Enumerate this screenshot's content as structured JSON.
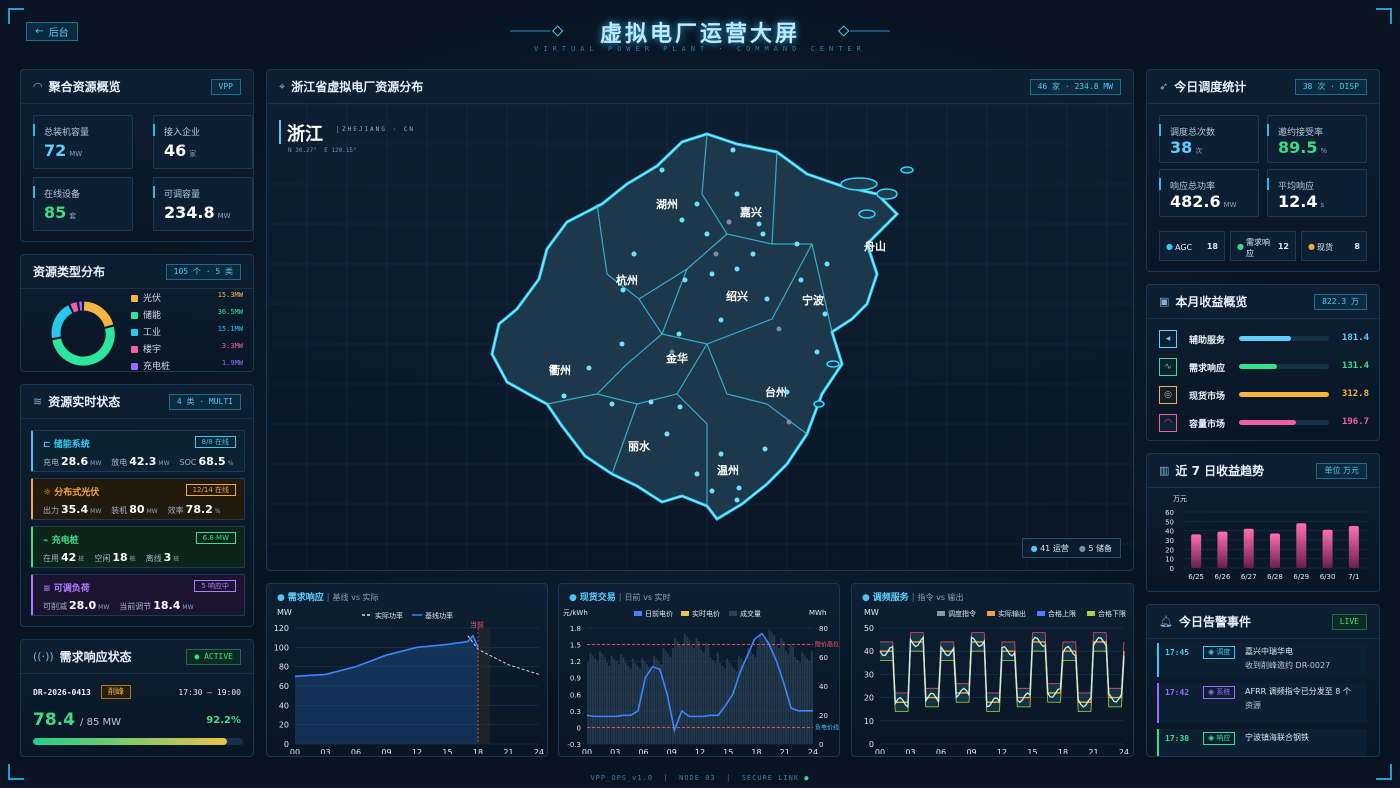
{
  "header": {
    "back_label": "后台",
    "title": "虚拟电厂运营大屏",
    "subtitle": "VIRTUAL POWER PLANT · COMMAND CENTER"
  },
  "footer": {
    "a": "VPP_OPS_v1.0",
    "b": "NODE 03",
    "c": "SECURE LINK"
  },
  "overview": {
    "title": "聚合资源概览",
    "tag": "VPP",
    "cards": [
      {
        "label": "总装机容量",
        "value": "72",
        "unit": "MW",
        "color": "#5fd0ff"
      },
      {
        "label": "接入企业",
        "value": "46",
        "unit": "家",
        "color": "#ffffff"
      },
      {
        "label": "在线设备",
        "value": "85",
        "unit": "套",
        "color": "#3ddc84"
      },
      {
        "label": "可调容量",
        "value": "234.8",
        "unit": "MW",
        "color": "#ffffff"
      }
    ]
  },
  "types": {
    "title": "资源类型分布",
    "tag": "105 个 · 5 类",
    "items": [
      {
        "name": "光伏",
        "value": "15.3MW",
        "num": 15.3,
        "color": "#f5b542"
      },
      {
        "name": "储能",
        "value": "36.5MW",
        "num": 36.5,
        "color": "#2ee59d"
      },
      {
        "name": "工业",
        "value": "15.1MW",
        "num": 15.1,
        "color": "#28c8e8"
      },
      {
        "name": "楼宇",
        "value": "3.3MW",
        "num": 3.3,
        "color": "#ef5fa6"
      },
      {
        "name": "充电桩",
        "value": "1.9MW",
        "num": 1.9,
        "color": "#9a6bff"
      }
    ]
  },
  "realtime": {
    "title": "资源实时状态",
    "tag": "4 类 · MULTI",
    "items": [
      {
        "icon": "⊏",
        "name": "储能系统",
        "badge": "8/8 在线",
        "color": "#3dc6f2",
        "bg": "#0b2233",
        "f": [
          {
            "k": "充电",
            "v": "28.6",
            "u": "MW"
          },
          {
            "k": "放电",
            "v": "42.3",
            "u": "MW"
          },
          {
            "k": "SOC",
            "v": "68.5",
            "u": "%"
          }
        ]
      },
      {
        "icon": "☼",
        "name": "分布式光伏",
        "badge": "12/14 在线",
        "color": "#f5a83a",
        "bg": "#231a0e",
        "f": [
          {
            "k": "出力",
            "v": "35.4",
            "u": "MW"
          },
          {
            "k": "装机",
            "v": "80",
            "u": "MW"
          },
          {
            "k": "效率",
            "v": "78.2",
            "u": "%"
          }
        ]
      },
      {
        "icon": "⌁",
        "name": "充电桩",
        "badge": "6.8 MW",
        "color": "#36e08a",
        "bg": "#0c2419",
        "f": [
          {
            "k": "在用",
            "v": "42",
            "u": "桩"
          },
          {
            "k": "空闲",
            "v": "18",
            "u": "桩"
          },
          {
            "k": "离线",
            "v": "3",
            "u": "桩"
          }
        ]
      },
      {
        "icon": "≡",
        "name": "可调负荷",
        "badge": "5 响应中",
        "color": "#b07bff",
        "bg": "#1b1430",
        "f": [
          {
            "k": "可削减",
            "v": "28.0",
            "u": "MW"
          },
          {
            "k": "当前调节",
            "v": "18.4",
            "u": "MW"
          }
        ]
      }
    ]
  },
  "dr": {
    "title": "需求响应状态",
    "tag": "● ACTIVE",
    "id": "DR-2026-0413",
    "badge": "削峰",
    "time": "17:30 – 19:00",
    "value": "78.4",
    "target": "/ 85 MW",
    "pct": "92.2%",
    "progress": 0.922
  },
  "map": {
    "title": "浙江省虚拟电厂资源分布",
    "tag": "46 家 · 234.8 MW",
    "region": "浙江",
    "region_en": "ZHEJIANG · CN",
    "coords": "N 30.27°  E 120.15°",
    "cities": [
      "湖州",
      "嘉兴",
      "舟山",
      "杭州",
      "绍兴",
      "宁波",
      "衢州",
      "金华",
      "台州",
      "丽水",
      "温州"
    ],
    "legend_a": "41 运营",
    "legend_b": "5 储备"
  },
  "dispatch": {
    "title": "今日调度统计",
    "tag": "38 次 · DISP",
    "cards": [
      {
        "label": "调度总次数",
        "value": "38",
        "unit": "次",
        "color": "#5fd0ff"
      },
      {
        "label": "邀约接受率",
        "value": "89.5",
        "unit": "%",
        "color": "#3ddc84"
      },
      {
        "label": "响应总功率",
        "value": "482.6",
        "unit": "MW",
        "color": "#ffffff"
      },
      {
        "label": "平均响应",
        "value": "12.4",
        "unit": "s",
        "color": "#ffffff"
      }
    ],
    "chips": [
      {
        "label": "AGC",
        "value": "18",
        "color": "#3dc6f2"
      },
      {
        "label": "需求响应",
        "value": "12",
        "color": "#36e08a"
      },
      {
        "label": "现货",
        "value": "8",
        "color": "#f5a83a"
      }
    ]
  },
  "revenue": {
    "title": "本月收益概览",
    "tag": "822.3 万",
    "items": [
      {
        "icon": "◂",
        "name": "辅助服务",
        "value": "181.4",
        "ratio": 0.58,
        "color": "#5fd0ff"
      },
      {
        "icon": "∿",
        "name": "需求响应",
        "value": "131.4",
        "ratio": 0.42,
        "color": "#36e08a"
      },
      {
        "icon": "◎",
        "name": "现货市场",
        "value": "312.8",
        "ratio": 1.0,
        "color": "#f5b542"
      },
      {
        "icon": "◠",
        "name": "容量市场",
        "value": "196.7",
        "ratio": 0.63,
        "color": "#ef5fa6"
      }
    ]
  },
  "trend": {
    "title": "近 7 日收益趋势",
    "tag": "单位 万元",
    "unit": "万元"
  },
  "alerts": {
    "title": "今日告警事件",
    "tag": "LIVE",
    "items": [
      {
        "time": "17:45",
        "src": "调度",
        "text": "嘉兴中瑞华电",
        "text2": "收到削峰邀约 DR-0027",
        "color": "#3dc6f2"
      },
      {
        "time": "17:42",
        "src": "系统",
        "text": "AFRR 调频指令已分发至 8 个",
        "text2": "资源",
        "color": "#9a6bff"
      },
      {
        "time": "17:38",
        "src": "响应",
        "text": "宁波镇海联合钢铁",
        "text2": "",
        "color": "#36e08a"
      }
    ]
  },
  "chart_data": [
    {
      "type": "line",
      "title": "需求响应",
      "subtitle": "基线 vs 实际",
      "ylabel": "MW",
      "ylim": [
        0,
        120
      ],
      "x": [
        0,
        3,
        6,
        9,
        12,
        15,
        17,
        18,
        21,
        24
      ],
      "series": [
        {
          "name": "基线功率",
          "values": [
            null,
            null,
            null,
            null,
            null,
            null,
            112,
            98,
            82,
            72
          ]
        },
        {
          "name": "实际功率",
          "values": [
            70,
            72,
            80,
            92,
            100,
            103,
            106,
            null,
            null,
            null
          ]
        }
      ],
      "annotation": "当前",
      "xticks": [
        "00",
        "03",
        "06",
        "09",
        "12",
        "15",
        "18",
        "21",
        "24"
      ],
      "yticks": [
        0,
        20,
        40,
        60,
        80,
        100,
        120
      ]
    },
    {
      "type": "bar",
      "title": "现货交易",
      "subtitle": "日前 vs 实时",
      "ylabel": "元/kWh",
      "ylabel2": "MWh",
      "ylim": [
        -0.3,
        1.8
      ],
      "ylim2": [
        0,
        80
      ],
      "series": [
        {
          "name": "日前电价"
        },
        {
          "name": "实时电价"
        },
        {
          "name": "成交量"
        }
      ],
      "price": [
        0.2,
        0.2,
        0.2,
        0.2,
        0.2,
        0.25,
        0.6,
        1.1,
        0.9,
        0.4,
        0.15,
        -0.15,
        0.2,
        0.2,
        0.2,
        0.3,
        0.7,
        1.2,
        1.7,
        0.6,
        0.4,
        0.3,
        0.3
      ],
      "volume": [
        60,
        60,
        58,
        58,
        56,
        55,
        55,
        58,
        62,
        70,
        72,
        70,
        66,
        60,
        55,
        54,
        58,
        62,
        72,
        75,
        70,
        65,
        60
      ],
      "annotations": [
        "限价高位",
        "负电价线"
      ],
      "xticks": [
        "00",
        "03",
        "06",
        "09",
        "12",
        "15",
        "18",
        "21",
        "24"
      ],
      "yticks": [
        "1.8",
        "1.5",
        "1.2",
        "0.9",
        "0.6",
        "0.3",
        "0",
        "-0.3"
      ],
      "yticks2": [
        "80",
        "60",
        "40",
        "20",
        "0"
      ]
    },
    {
      "type": "line",
      "title": "调频服务",
      "subtitle": "指令 vs 输出",
      "ylabel": "MW",
      "ylim": [
        0,
        50
      ],
      "series": [
        {
          "name": "调度指令"
        },
        {
          "name": "实际输出"
        },
        {
          "name": "合格上限"
        },
        {
          "name": "合格下限"
        }
      ],
      "xticks": [
        "00",
        "03",
        "06",
        "09",
        "12",
        "15",
        "18",
        "21",
        "24"
      ],
      "yticks": [
        0,
        10,
        20,
        30,
        40,
        50
      ]
    },
    {
      "type": "bar",
      "title": "近 7 日收益趋势",
      "ylabel": "万元",
      "ylim": [
        0,
        60
      ],
      "categories": [
        "6/25",
        "6/26",
        "6/27",
        "6/28",
        "6/29",
        "6/30",
        "7/1"
      ],
      "values": [
        36,
        39,
        42,
        37,
        48,
        41,
        45
      ],
      "yticks": [
        0,
        10,
        20,
        30,
        40,
        50,
        60
      ]
    }
  ]
}
